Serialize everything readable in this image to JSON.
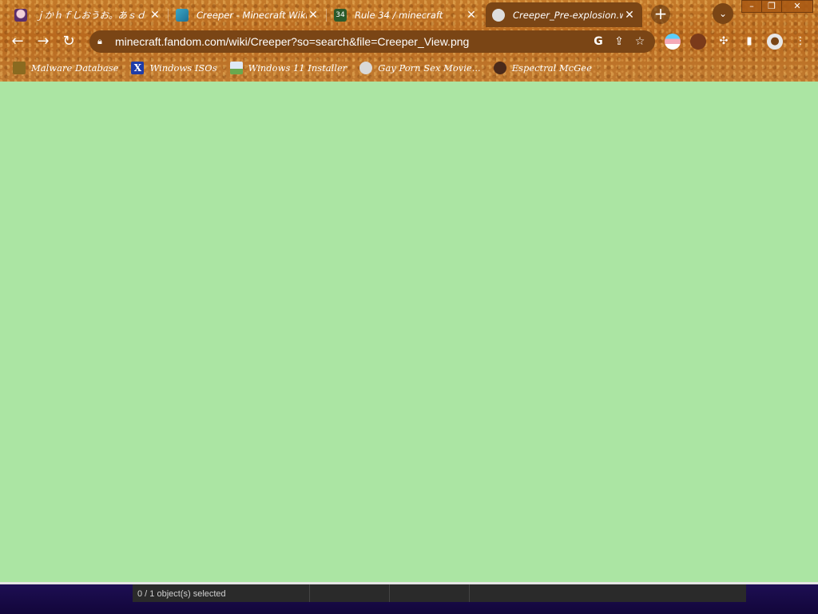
{
  "tabs": [
    {
      "title": "ｊかｈｆしおうお。あｓｄ",
      "favicon": "anime-avatar-icon",
      "active": false
    },
    {
      "title": "Creeper - Minecraft Wiki",
      "favicon": "fandom-icon",
      "active": false
    },
    {
      "title": "Rule 34 / minecraft",
      "favicon": "rule34-icon",
      "active": false
    },
    {
      "title": "Creeper_Pre-explosion.we",
      "favicon": "globe-icon",
      "active": true
    }
  ],
  "window_controls": {
    "minimize": "–",
    "restore": "❐",
    "close": "✕"
  },
  "toolbar": {
    "url": "minecraft.fandom.com/wiki/Creeper?so=search&file=Creeper_View.png",
    "back": "←",
    "forward": "→",
    "reload": "↻"
  },
  "bookmarks": [
    {
      "label": "Malware Database",
      "icon": "folder-icon"
    },
    {
      "label": "Windows ISOs",
      "icon": "x-logo-icon"
    },
    {
      "label": "Windows 11 Installer",
      "icon": "image-icon"
    },
    {
      "label": "Gay Porn Sex Movie...",
      "icon": "skull-icon"
    },
    {
      "label": "Espectral McGee",
      "icon": "character-icon"
    }
  ],
  "content": {
    "background": "#abe5a3"
  },
  "status": {
    "text": "0 / 1 object(s) selected"
  },
  "colors": {
    "chrome": "#c47a2a",
    "active_tab": "#7a4515",
    "taskbar": "#1e0f55"
  }
}
